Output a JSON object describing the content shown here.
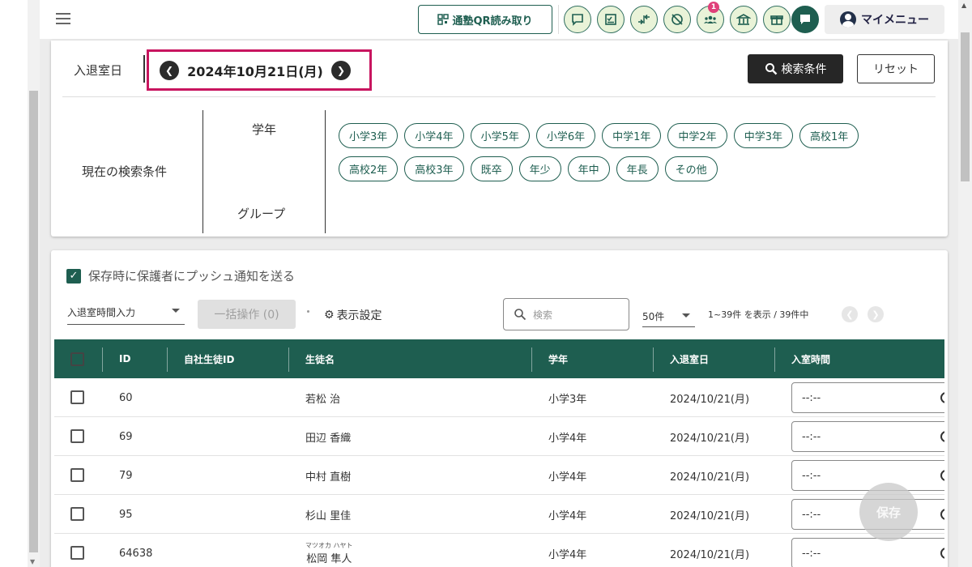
{
  "topbar": {
    "qr_label": "通塾QR読み取り",
    "notification_badge": "1",
    "mymenu_label": "マイメニュー"
  },
  "search": {
    "date_label": "入退室日",
    "date_value": "2024年10月21日(月)",
    "search_conditions_label": "検索条件",
    "reset_label": "リセット",
    "current_conditions_label": "現在の検索条件",
    "grade_label": "学年",
    "group_label": "グループ",
    "grade_chips": [
      "小学3年",
      "小学4年",
      "小学5年",
      "小学6年",
      "中学1年",
      "中学2年",
      "中学3年",
      "高校1年",
      "高校2年",
      "高校3年",
      "既卒",
      "年少",
      "年中",
      "年長",
      "その他"
    ]
  },
  "list": {
    "push_label": "保存時に保護者にプッシュ通知を送る",
    "time_select_value": "入退室時間入力",
    "bulk_label": "一括操作 (0)",
    "display_settings_label": "表示設定",
    "search_placeholder": "検索",
    "per_page_value": "50件",
    "count_text": "1~39件 を表示 / 39件中",
    "save_label": "保存"
  },
  "table": {
    "headers": {
      "id": "ID",
      "own_id": "自社生徒ID",
      "name": "生徒名",
      "grade": "学年",
      "date": "入退室日",
      "entry_time": "入室時間"
    },
    "rows": [
      {
        "id": "60",
        "name": "若松 治",
        "kana": "",
        "grade": "小学3年",
        "date": "2024/10/21(月)",
        "time": "--:--"
      },
      {
        "id": "69",
        "name": "田辺 香織",
        "kana": "",
        "grade": "小学4年",
        "date": "2024/10/21(月)",
        "time": "--:--"
      },
      {
        "id": "79",
        "name": "中村 直樹",
        "kana": "",
        "grade": "小学4年",
        "date": "2024/10/21(月)",
        "time": "--:--"
      },
      {
        "id": "95",
        "name": "杉山 里佳",
        "kana": "",
        "grade": "小学4年",
        "date": "2024/10/21(月)",
        "time": "--:--"
      },
      {
        "id": "64638",
        "name": "松岡 隼人",
        "kana": "マツオカ ハヤト",
        "grade": "小学4年",
        "date": "2024/10/21(月)",
        "time": "--:--"
      }
    ]
  }
}
